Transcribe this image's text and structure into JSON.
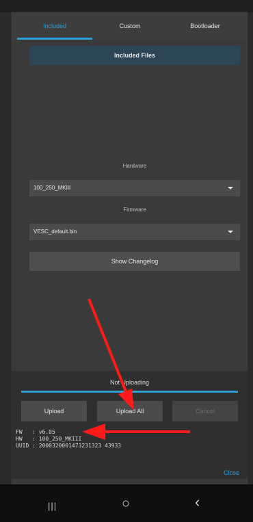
{
  "tabs": [
    {
      "label": "Included",
      "active": true
    },
    {
      "label": "Custom",
      "active": false
    },
    {
      "label": "Bootloader",
      "active": false
    }
  ],
  "included": {
    "header": "Included Files",
    "hardware_label": "Hardware",
    "hardware_value": "100_250_MKIII",
    "firmware_label": "Firmware",
    "firmware_value": "VESC_default.bin",
    "changelog_button": "Show Changelog"
  },
  "upload": {
    "status_label": "Not Uploading",
    "upload_button": "Upload",
    "upload_all_button": "Upload All",
    "cancel_button": "Cancel",
    "fw_line": "FW   : v6.05",
    "hw_line": "HW   : 100_250_MKIII",
    "uuid_line": "UUID : 2000320001473231323 43933",
    "close_button": "Close"
  },
  "navbar": {
    "recent_glyph": "|||",
    "home_glyph": "○",
    "back_glyph": "‹"
  },
  "colors": {
    "accent": "#2e9fd8",
    "annotation_arrow": "#ff1a1a"
  }
}
